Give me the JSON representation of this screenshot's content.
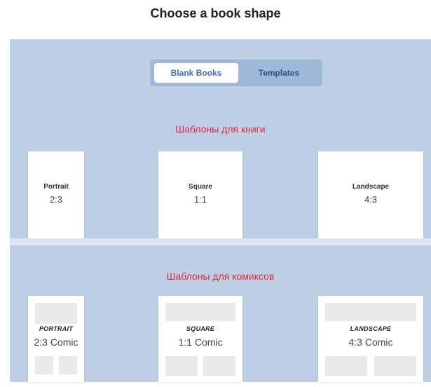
{
  "page_title": "Choose a book shape",
  "toggle": {
    "blank_books": "Blank Books",
    "templates": "Templates"
  },
  "sections": {
    "books_label": "Шаблоны для книги",
    "comics_label": "Шаблоны для комиксов"
  },
  "book_cards": [
    {
      "name": "Portrait",
      "ratio": "2:3"
    },
    {
      "name": "Square",
      "ratio": "1:1"
    },
    {
      "name": "Landscape",
      "ratio": "4:3"
    }
  ],
  "comic_cards": [
    {
      "name": "PORTRAIT",
      "ratio": "2:3 Comic"
    },
    {
      "name": "SQUARE",
      "ratio": "1:1 Comic"
    },
    {
      "name": "LANDSCAPE",
      "ratio": "4:3 Comic"
    }
  ],
  "colors": {
    "panel": "#bccfe4",
    "accent_text": "#e0283d",
    "toggle_active_text": "#3e6fb2"
  }
}
